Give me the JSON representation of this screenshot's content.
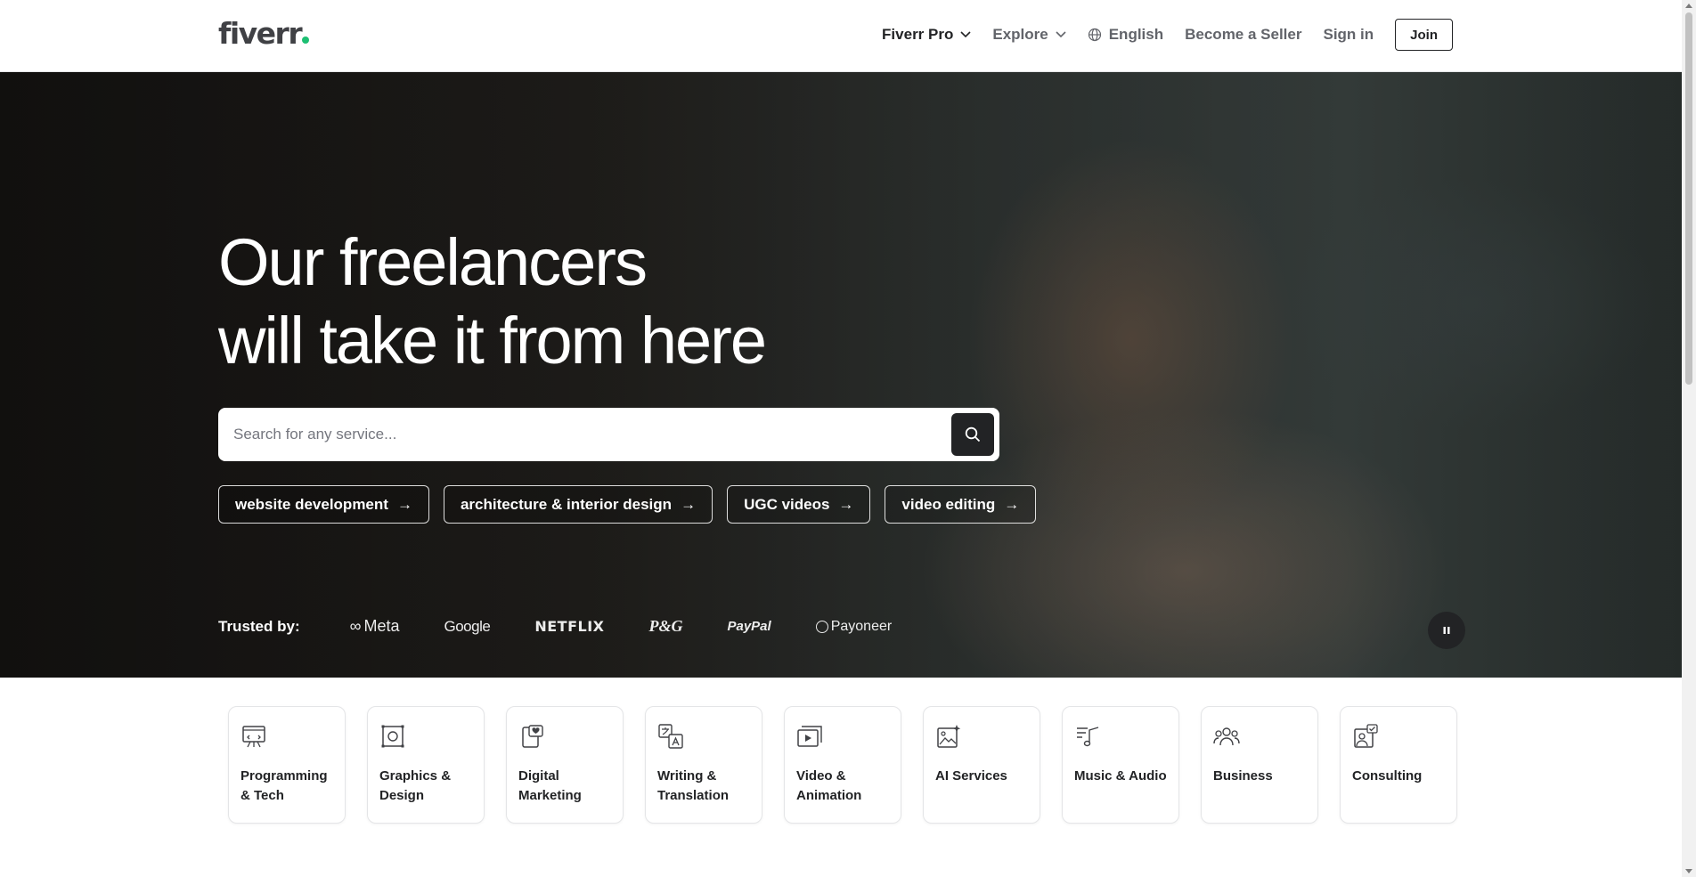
{
  "header": {
    "logo": "fiverr",
    "nav": {
      "fiverr_pro": "Fiverr Pro",
      "explore": "Explore",
      "language": "English",
      "become_seller": "Become a Seller",
      "sign_in": "Sign in",
      "join": "Join"
    }
  },
  "hero": {
    "headline_line1": "Our freelancers",
    "headline_line2": "will take it from here",
    "search_placeholder": "Search for any service...",
    "chips": [
      {
        "label": "website development"
      },
      {
        "label": "architecture & interior design"
      },
      {
        "label": "UGC videos"
      },
      {
        "label": "video editing"
      }
    ],
    "trusted_label": "Trusted by:",
    "brands": [
      "Meta",
      "Google",
      "NETFLIX",
      "P&G",
      "PayPal",
      "Payoneer"
    ]
  },
  "categories": [
    {
      "label": "Programming & Tech",
      "icon": "monitor-icon"
    },
    {
      "label": "Graphics & Design",
      "icon": "design-icon"
    },
    {
      "label": "Digital Marketing",
      "icon": "marketing-icon"
    },
    {
      "label": "Writing & Translation",
      "icon": "translation-icon"
    },
    {
      "label": "Video & Animation",
      "icon": "video-icon"
    },
    {
      "label": "AI Services",
      "icon": "ai-icon"
    },
    {
      "label": "Music & Audio",
      "icon": "music-icon"
    },
    {
      "label": "Business",
      "icon": "business-icon"
    },
    {
      "label": "Consulting",
      "icon": "consulting-icon"
    }
  ],
  "colors": {
    "brand_green": "#1dbf73",
    "dark": "#222325"
  }
}
